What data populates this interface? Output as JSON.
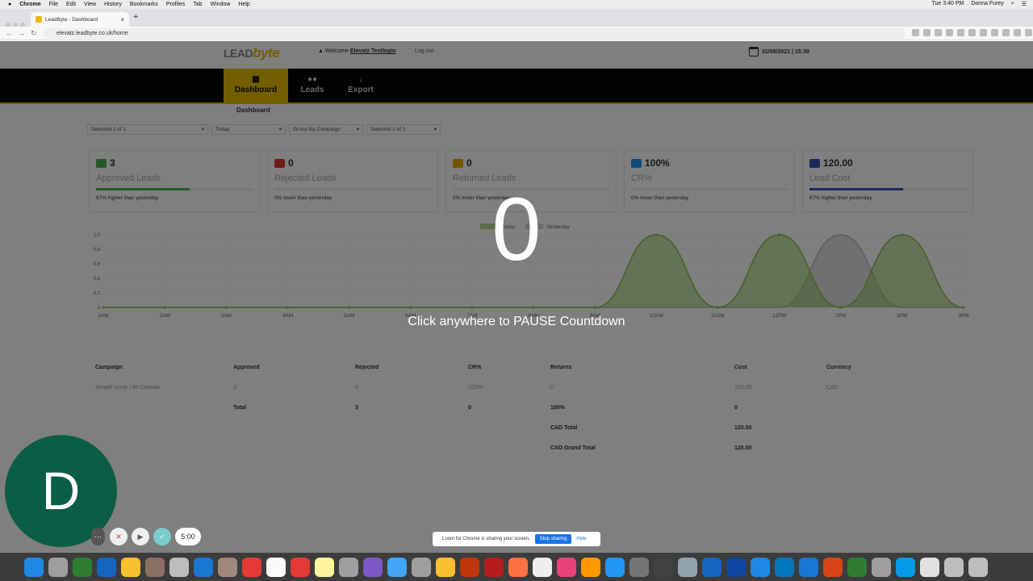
{
  "menubar": {
    "items": [
      "Chrome",
      "File",
      "Edit",
      "View",
      "History",
      "Bookmarks",
      "Profiles",
      "Tab",
      "Window",
      "Help"
    ],
    "clock": "Tue 3:40 PM",
    "user": "Donna Furey"
  },
  "browser": {
    "tab_title": "LeadByte - Dashboard",
    "url": "elevatz.leadbyte.co.uk/home"
  },
  "header": {
    "logo_lead": "LEAD",
    "logo_byte": "byte",
    "welcome_prefix": "Welcome",
    "welcome_user": "Elevatz Testlogin",
    "logout": "Log out",
    "datetime": "31/08/2021 | 15:39"
  },
  "nav": [
    {
      "label": "Dashboard",
      "icon": "grid-icon"
    },
    {
      "label": "Leads",
      "icon": "users-icon"
    },
    {
      "label": "Export",
      "icon": "arrow-down-icon"
    }
  ],
  "breadcrumb": "Dashboard",
  "filters": [
    "Selected 1 of 1",
    "Today",
    "Group By Campaign",
    "Selected 1 of 2"
  ],
  "cards": [
    {
      "value": "3",
      "label": "Approved Leads",
      "sub": "67% higher than yesterday",
      "color": "#4caf50",
      "fill": 0.6
    },
    {
      "value": "0",
      "label": "Rejected Leads",
      "sub": "0% lower than yesterday",
      "color": "#e53935",
      "fill": 0
    },
    {
      "value": "0",
      "label": "Returned Leads",
      "sub": "0% lower than yesterday",
      "color": "#e9a800",
      "fill": 0
    },
    {
      "value": "100%",
      "label": "CR%",
      "sub": "0% lower than yesterday",
      "color": "#2196f3",
      "fill": 0
    },
    {
      "value": "120.00",
      "label": "Lead Cost",
      "sub": "67% higher than yesterday",
      "color": "#3f51b5",
      "fill": 0.6
    }
  ],
  "chart_data": {
    "type": "area",
    "x": [
      "1AM",
      "2AM",
      "3AM",
      "4AM",
      "5AM",
      "6AM",
      "7AM",
      "8AM",
      "9AM",
      "10AM",
      "11AM",
      "12PM",
      "1PM",
      "2PM",
      "3PM"
    ],
    "ylim": [
      0,
      1.0
    ],
    "yticks": [
      "0",
      "0.2",
      "0.4",
      "0.6",
      "0.8",
      "1.0"
    ],
    "legend": [
      "Today",
      "Yesterday"
    ],
    "series": [
      {
        "name": "Today",
        "values": [
          0,
          0,
          0,
          0,
          0,
          0,
          0,
          0,
          0,
          1,
          0,
          1,
          0,
          1,
          0
        ],
        "color": "#8bc34a"
      },
      {
        "name": "Yesterday",
        "values": [
          0,
          0,
          0,
          0,
          0,
          0,
          0,
          0,
          0,
          0,
          0,
          0,
          1,
          0,
          0
        ],
        "color": "#bbbbbb"
      }
    ]
  },
  "table": {
    "headers": [
      "Campaign",
      "Approved",
      "Rejected",
      "CR%",
      "Returns",
      "Cost",
      "Currency"
    ],
    "row": [
      "Simple Issue Life Canada",
      "3",
      "0",
      "100%",
      "0",
      "120.00",
      "CAD"
    ],
    "total_label": "Total",
    "total": [
      "3",
      "0",
      "100%",
      "0"
    ],
    "cad_total_label": "CAD Total",
    "cad_total": "120.00",
    "grand_total_label": "CAD Grand Total",
    "grand_total": "120.00"
  },
  "overlay": {
    "countdown": "0",
    "message": "Click anywhere to PAUSE Countdown",
    "avatar_letter": "D",
    "timer": "5:00"
  },
  "share_bar": {
    "text": "Loom for Chrome is sharing your screen.",
    "stop": "Stop sharing",
    "hide": "Hide"
  },
  "dock_colors": [
    "#1e88e5",
    "#9e9e9e",
    "#2e7d32",
    "#1565c0",
    "#fbc02d",
    "#8d6e63",
    "#bdbdbd",
    "#1976d2",
    "#a1887f",
    "#e53935",
    "#fafafa",
    "#e53935",
    "#fff59d",
    "#9e9e9e",
    "#7e57c2",
    "#42a5f5",
    "#9e9e9e",
    "#fbc02d",
    "#bf360c",
    "#b71c1c",
    "#ff7043",
    "#eeeeee",
    "#ec407a",
    "#ff9800",
    "#2196f3",
    "#757575",
    "#424242",
    "#90a4ae",
    "#1565c0",
    "#0d47a1",
    "#1e88e5",
    "#0277bd",
    "#1976d2",
    "#d84315",
    "#2e7d32",
    "#9e9e9e",
    "#039be5",
    "#e0e0e0",
    "#bdbdbd",
    "#bdbdbd"
  ]
}
